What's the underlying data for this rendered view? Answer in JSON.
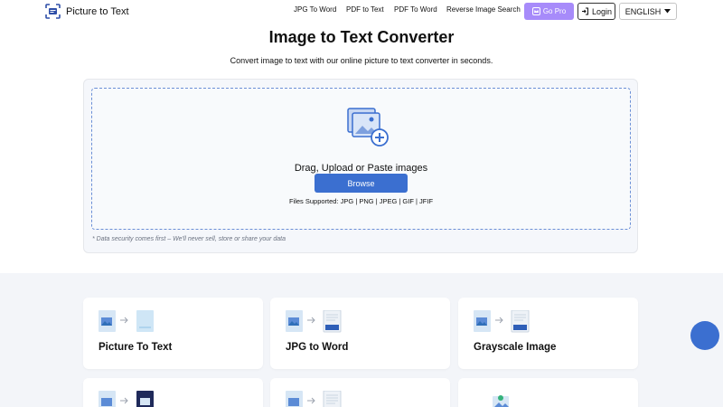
{
  "header": {
    "logo_text": "Picture to Text",
    "nav": [
      "JPG To Word",
      "PDF to Text",
      "PDF To Word",
      "Reverse Image Search"
    ],
    "gopro_label": "Go Pro",
    "login_label": "Login",
    "language": "ENGLISH"
  },
  "main": {
    "title": "Image to Text Converter",
    "subtitle": "Convert image to text with our online picture to text converter in seconds."
  },
  "upload": {
    "prompt": "Drag, Upload or Paste images",
    "browse_label": "Browse",
    "files_supported": "Files Supported: JPG | PNG | JPEG | GIF | JFIF",
    "security_note": "* Data security comes first – We'll never sell, store or share your data"
  },
  "tools": [
    {
      "title": "Picture To Text",
      "icon": "image-to-text-icon"
    },
    {
      "title": "JPG to Word",
      "icon": "jpg-to-word-icon"
    },
    {
      "title": "Grayscale Image",
      "icon": "grayscale-icon"
    }
  ],
  "colors": {
    "accent": "#3b6fd0",
    "gopro": "#a78bfa",
    "dropzone_border": "#6b8fd6",
    "section_bg": "#f3f5f9"
  }
}
